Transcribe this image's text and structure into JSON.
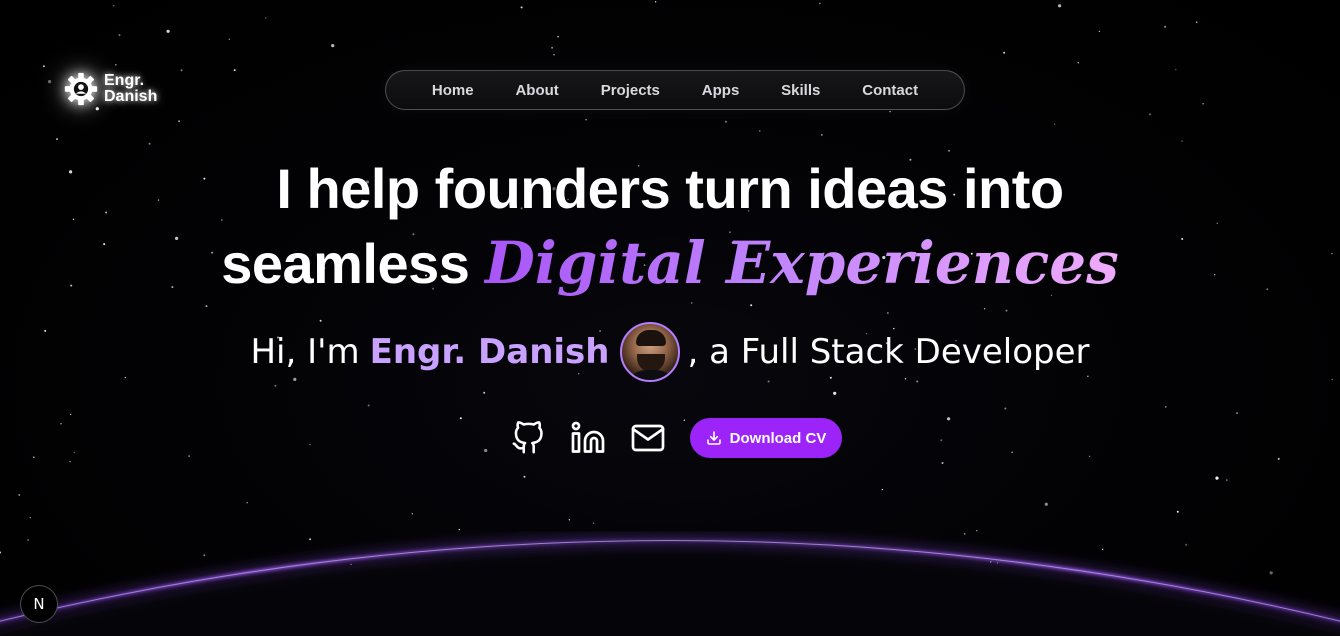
{
  "logo": {
    "line1": "Engr.",
    "line2": "Danish",
    "icon": "gear-icon"
  },
  "nav": {
    "items": [
      {
        "label": "Home"
      },
      {
        "label": "About"
      },
      {
        "label": "Projects"
      },
      {
        "label": "Apps"
      },
      {
        "label": "Skills"
      },
      {
        "label": "Contact"
      }
    ]
  },
  "hero": {
    "headline_line1": "I help founders turn ideas into",
    "headline_line2_prefix": "seamless",
    "headline_accent": "Digital Experiences",
    "intro_prefix": "Hi, I'm",
    "intro_name": "Engr. Danish",
    "intro_suffix": ", a Full Stack Developer"
  },
  "actions": {
    "github_icon": "github-icon",
    "linkedin_icon": "linkedin-icon",
    "mail_icon": "mail-icon",
    "download_label": "Download CV",
    "download_icon": "download-icon"
  },
  "dev_badge": {
    "label": "N"
  },
  "colors": {
    "accent": "#9c24f9",
    "name": "#c9a2ff",
    "horizon": "#a56cf0",
    "accent_gradient_start": "#a855f7",
    "accent_gradient_end": "#f0abfc"
  }
}
